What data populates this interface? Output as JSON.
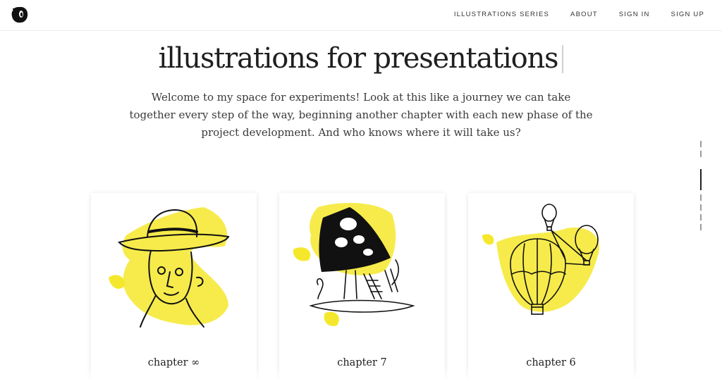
{
  "header": {
    "logo_icon": "ink-blob-logo-icon",
    "nav": [
      {
        "label": "ILLUSTRATIONS SERIES"
      },
      {
        "label": "ABOUT"
      },
      {
        "label": "SIGN IN"
      },
      {
        "label": "SIGN UP"
      }
    ]
  },
  "hero": {
    "title": "illustrations for presentations",
    "intro": "Welcome to my space for experiments! Look at this like a journey we can take together every step of the way, beginning another chapter with each new phase of the project development. And who knows where it will take us?"
  },
  "cards": [
    {
      "caption": "chapter ∞",
      "icon": "hat-face-illustration-icon"
    },
    {
      "caption": "chapter 7",
      "icon": "mushroom-illustration-icon"
    },
    {
      "caption": "chapter 6",
      "icon": "hot-air-balloons-illustration-icon"
    }
  ],
  "colors": {
    "accent_yellow": "#f5e82c",
    "ink": "#111111"
  }
}
